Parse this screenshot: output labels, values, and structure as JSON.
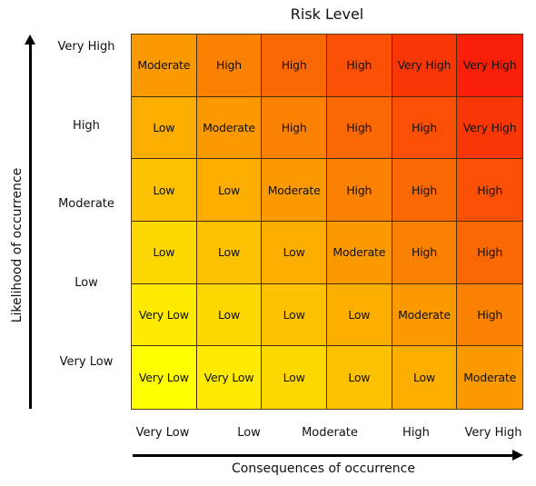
{
  "chart_data": {
    "type": "heatmap",
    "title": "Risk Level",
    "xlabel": "Consequences of occurrence",
    "ylabel": "Likelihood of occurrence",
    "x_tick_labels": [
      "Very Low",
      "Low",
      "Moderate",
      "High",
      "Very High"
    ],
    "y_tick_labels": [
      "Very High",
      "High",
      "Moderate",
      "Low",
      "Very Low"
    ],
    "columns": 6,
    "rows_top_to_bottom": [
      [
        "Moderate",
        "High",
        "High",
        "High",
        "Very High",
        "Very High"
      ],
      [
        "Low",
        "Moderate",
        "High",
        "High",
        "High",
        "Very High"
      ],
      [
        "Low",
        "Low",
        "Moderate",
        "High",
        "High",
        "High"
      ],
      [
        "Low",
        "Low",
        "Low",
        "Moderate",
        "High",
        "High"
      ],
      [
        "Very Low",
        "Low",
        "Low",
        "Low",
        "Moderate",
        "High"
      ],
      [
        "Very Low",
        "Very Low",
        "Low",
        "Low",
        "Low",
        "Moderate"
      ]
    ],
    "color_scale": {
      "low_corner": "#FFFF00",
      "mid": "#FA9A00",
      "high_corner": "#F91E08",
      "direction": "bottom-left to top-right"
    },
    "grid": true
  }
}
